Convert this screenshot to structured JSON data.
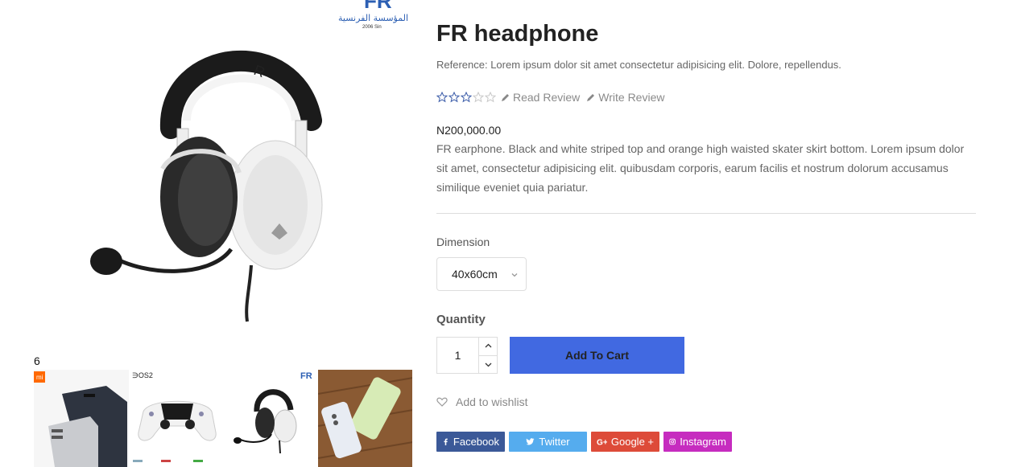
{
  "product": {
    "title": "FR headphone",
    "reference": "Reference: Lorem ipsum dolor sit amet consectetur adipisicing elit. Dolore, repellendus.",
    "rating": 3,
    "rating_max": 5,
    "read_review": "Read Review",
    "write_review": "Write Review",
    "price": "N200,000.00",
    "description": "FR earphone. Black and white striped top and orange high waisted skater skirt bottom. Lorem ipsum dolor sit amet, consectetur adipisicing elit. quibusdam corporis, earum facilis et nostrum dolorum accusamus similique eveniet quia pariatur."
  },
  "gallery": {
    "brand_logo_text": "FR",
    "brand_logo_arabic": "المؤسسة الفرنسية",
    "brand_logo_since": "2006 Sin",
    "thumb_count": "6",
    "thumbs": [
      {
        "name": "power bank"
      },
      {
        "name": "game controller"
      },
      {
        "name": "headset"
      },
      {
        "name": "phones"
      }
    ]
  },
  "options": {
    "dimension_label": "Dimension",
    "dimension_value": "40x60cm",
    "quantity_label": "Quantity",
    "quantity_value": "1",
    "add_to_cart": "Add To Cart",
    "wishlist": "Add to wishlist"
  },
  "social": {
    "facebook": "Facebook",
    "twitter": "Twitter",
    "google": "Google +",
    "instagram": "Instagram"
  },
  "colors": {
    "accent": "#4169e1",
    "star": "#3a5ba8",
    "facebook": "#3b5998",
    "twitter": "#55acee",
    "google": "#dd4b39",
    "instagram": "#c62cbf"
  }
}
